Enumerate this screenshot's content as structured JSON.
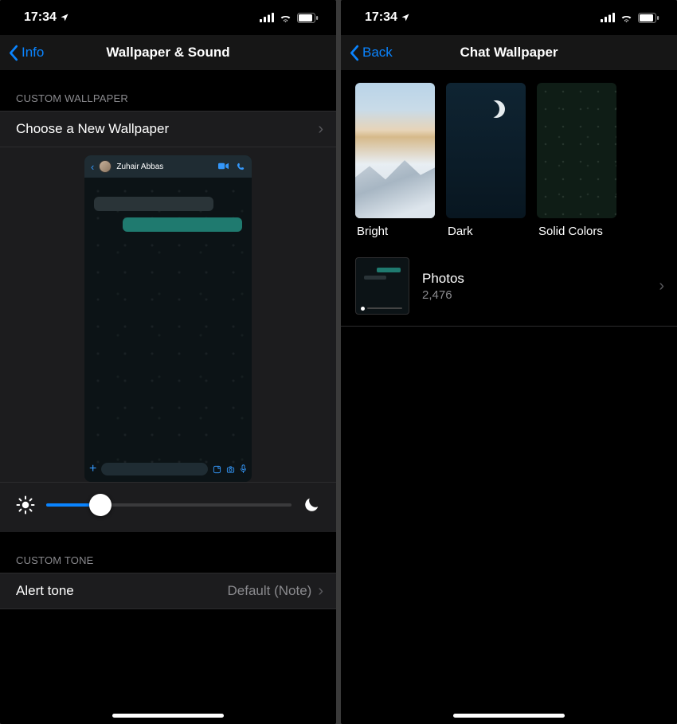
{
  "status": {
    "time": "17:34",
    "location_arrow": "➤"
  },
  "left": {
    "back_label": "Info",
    "title": "Wallpaper & Sound",
    "section_wallpaper": "Custom Wallpaper",
    "choose_wallpaper": "Choose a New Wallpaper",
    "chat_name": "Zuhair Abbas",
    "section_tone": "Custom Tone",
    "alert_tone_label": "Alert tone",
    "alert_tone_value": "Default (Note)"
  },
  "right": {
    "back_label": "Back",
    "title": "Chat Wallpaper",
    "thumb_bright": "Bright",
    "thumb_dark": "Dark",
    "thumb_solid": "Solid Colors",
    "photos_label": "Photos",
    "photos_count": "2,476"
  }
}
